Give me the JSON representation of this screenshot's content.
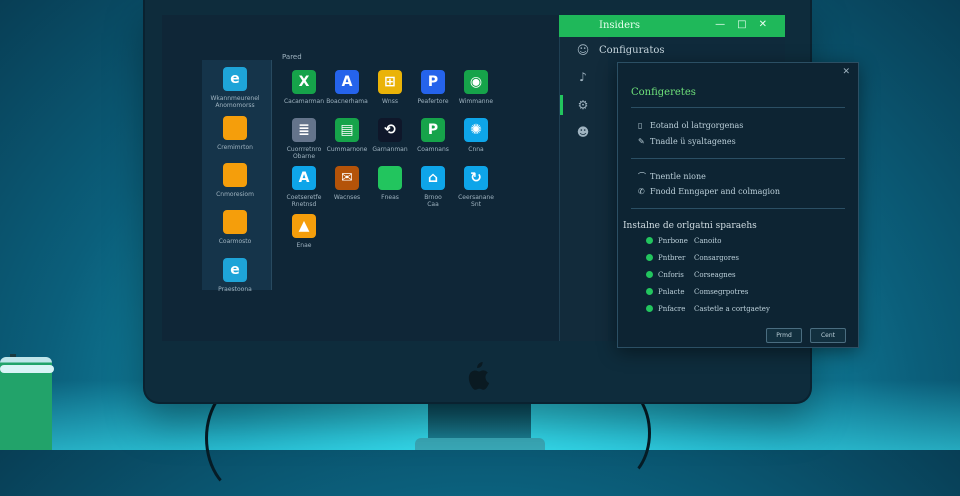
{
  "insiders_title": "Insiders",
  "window_controls": [
    "—",
    "□",
    "✕"
  ],
  "config_header": "Configuratos",
  "left": {
    "section_label": "Pared",
    "column_items": [
      {
        "label": "Wkannmeurenel\nAnomomorss",
        "icon": "ie-icon",
        "color": "#1ea4d8"
      },
      {
        "label": "Cremimrton",
        "icon": "folder-icon",
        "color": "#f59e0b"
      },
      {
        "label": "Cnmoresiom",
        "icon": "folder-user-icon",
        "color": "#f59e0b"
      },
      {
        "label": "Coarmosto",
        "icon": "folder-icon",
        "color": "#f59e0b"
      },
      {
        "label": "Praestoona",
        "icon": "edge-icon",
        "color": "#1ea4d8"
      }
    ],
    "grid_items": [
      {
        "label": "Cacamarman",
        "icon": "excel-icon",
        "glyph": "X",
        "color": "#16a34a"
      },
      {
        "label": "Boacnerhama",
        "icon": "word-icon",
        "glyph": "A",
        "color": "#2563eb"
      },
      {
        "label": "Wnss",
        "icon": "windows-icon",
        "glyph": "⊞",
        "color": "#eab308"
      },
      {
        "label": "Peafertore",
        "icon": "powerpoint-icon",
        "glyph": "P",
        "color": "#2563eb"
      },
      {
        "label": "Wimmanne",
        "icon": "chrome-icon",
        "glyph": "◉",
        "color": "#16a34a"
      },
      {
        "label": "Cuorrretnro\nObarne",
        "icon": "document-icon",
        "glyph": "≣",
        "color": "#64748b"
      },
      {
        "label": "Cummarnone",
        "icon": "file-icon",
        "glyph": "▤",
        "color": "#16a34a"
      },
      {
        "label": "Garnanman",
        "icon": "refresh-icon",
        "glyph": "⟲",
        "color": "#0f172a"
      },
      {
        "label": "Coamnans",
        "icon": "picsart-icon",
        "glyph": "P",
        "color": "#16a34a"
      },
      {
        "label": "Cnna",
        "icon": "settings-icon",
        "glyph": "✺",
        "color": "#0ea5e9"
      },
      {
        "label": "Coetseretfe\nRnetnsd",
        "icon": "app-icon",
        "glyph": "A",
        "color": "#0ea5e9"
      },
      {
        "label": "Wacnses",
        "icon": "store-icon",
        "glyph": "✉",
        "color": "#b45309"
      },
      {
        "label": "Fneas",
        "icon": "folder-icon",
        "glyph": "",
        "color": "#22c55e"
      },
      {
        "label": "Brnoo\nCaa",
        "icon": "home-icon",
        "glyph": "⌂",
        "color": "#0ea5e9"
      },
      {
        "label": "Ceersanane\nSnt",
        "icon": "sync-icon",
        "glyph": "↻",
        "color": "#0ea5e9"
      },
      {
        "label": "Enae",
        "icon": "drive-icon",
        "glyph": "▲",
        "color": "#f59e0b"
      }
    ]
  },
  "nav_icons": [
    "emoji-icon",
    "voice-icon",
    "security-icon",
    "privacy-icon"
  ],
  "dialog": {
    "title": "Configeretes",
    "close": "✕",
    "group1": [
      {
        "icon": "file-icon",
        "text": "Eotand ol latrgorgenas"
      },
      {
        "icon": "pen-icon",
        "text": "Tnadle ü syaltagenes"
      }
    ],
    "group2": [
      {
        "icon": "fingerprint-icon",
        "text": "Tnentle nione"
      },
      {
        "icon": "phone-icon",
        "text": "Fnodd Enngaper and colmagion"
      }
    ],
    "checklist_title": "Instalne de orlgatni sparaehs",
    "checklist": [
      {
        "a": "Pnrbone",
        "b": "Canoito"
      },
      {
        "a": "Pntbrer",
        "b": "Consargores"
      },
      {
        "a": "Cnforis",
        "b": "Corseagnes"
      },
      {
        "a": "Pnlacte",
        "b": "Comsegrpotres"
      },
      {
        "a": "Pnfacre",
        "b": "Castetle a cortgaetey"
      }
    ],
    "btn_primary": "Prmd",
    "btn_secondary": "Cent"
  }
}
